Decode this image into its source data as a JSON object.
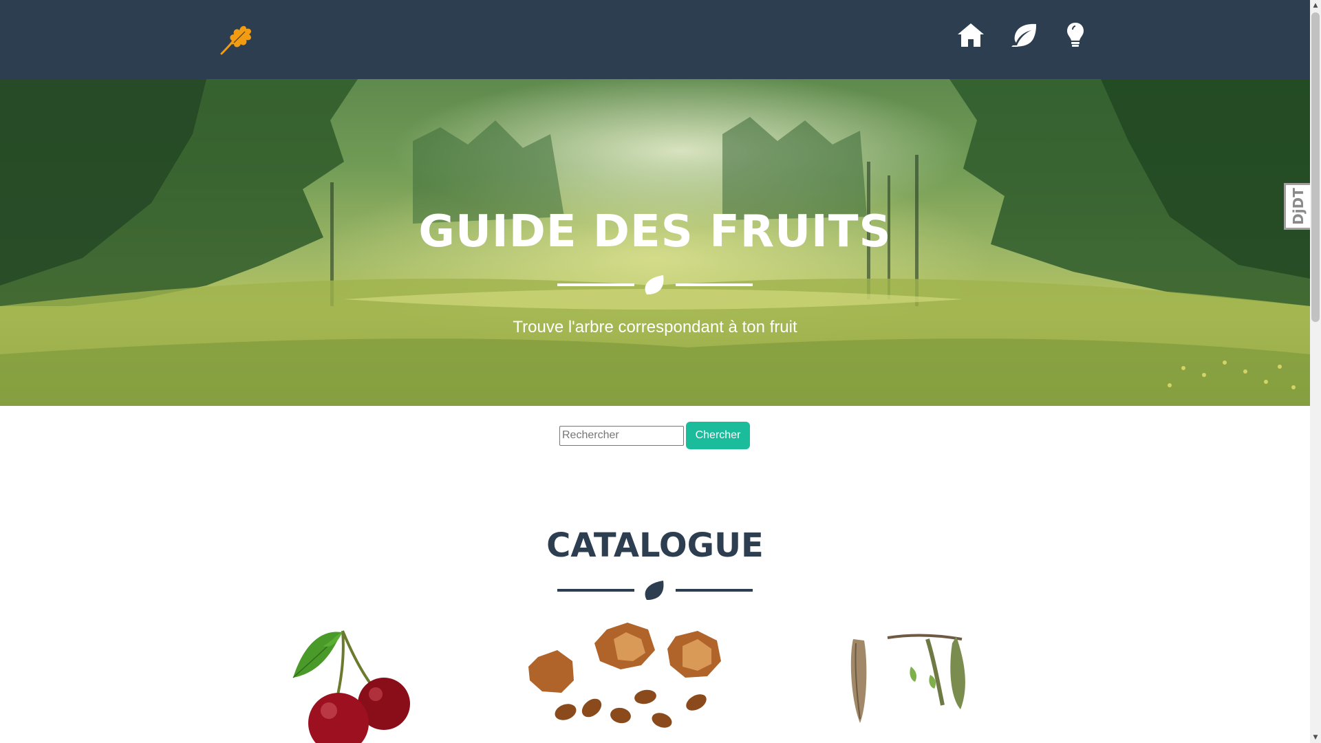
{
  "navbar": {
    "brand_icon": "oak-leaf-icon",
    "brand_color": "#f39c12",
    "background": "#2c3e50",
    "nav_icons": [
      "home-icon",
      "leaf-icon",
      "lightbulb-icon"
    ]
  },
  "hero": {
    "title": "GUIDE DES FRUITS",
    "subtitle": "Trouve l'arbre correspondant à ton fruit",
    "divider_icon": "leaf-icon"
  },
  "search": {
    "placeholder": "Rechercher",
    "button_label": "Chercher",
    "button_color": "#1abc9c"
  },
  "catalogue": {
    "title": "CATALOGUE",
    "divider_icon": "leaf-icon",
    "items": [
      "cherry-image",
      "beech-nut-image",
      "catkin-image"
    ]
  },
  "debug_toolbar": {
    "label": "DjDT"
  }
}
